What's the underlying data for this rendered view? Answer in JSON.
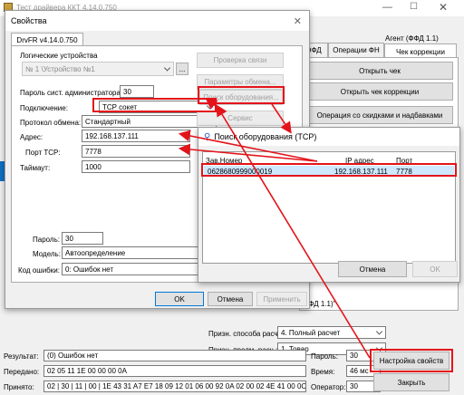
{
  "main_window": {
    "title": "Тест драйвера ККТ 4.14.0.750",
    "tabs": [
      "ОФД",
      "Операции ФН",
      "Чек коррекции"
    ],
    "agent_label": "Агент (ФФД 1.1)",
    "buttons": [
      "Открыть чек",
      "Открыть чек коррекции",
      "Операция со скидками и надбавками"
    ],
    "agent_note": "\"Агент (ФФД 1.1)\"",
    "calc_method_label": "Призн. способа расч.:",
    "calc_method_value": "4. Полный расчет",
    "item_type_label": "Призн. предм. расч.:",
    "item_type_value": "1. Товар",
    "status": {
      "result_label": "Результат:",
      "result_value": "(0) Ошибок нет",
      "sent_label": "Передано:",
      "sent_value": "02 05 11 1E 00 00 00 0A",
      "received_label": "Принято:",
      "received_value": "02 | 30 | 11 | 00 | 1E 43 31 A7 E7 18 09 12 01 06 00 92 0A 02 00 02 4E 41 00 0C",
      "password_label": "Пароль:",
      "password_value": "30",
      "time_label": "Время:",
      "time_value": "46 мс",
      "operator_label": "Оператор:",
      "operator_value": "30"
    },
    "settings_button": "Настройка свойств",
    "close_button": "Закрыть"
  },
  "props_dialog": {
    "title": "Свойства",
    "tab": "DrvFR v4.14.0.750",
    "logical_devices_label": "Логические устройства",
    "logical_device_value": "№ 1 \\Устройство №1",
    "sys_password_label": "Пароль сист. администратора:",
    "sys_password_value": "30",
    "connection_label": "Подключение:",
    "connection_value": "TCP сокет",
    "protocol_label": "Протокол обмена:",
    "protocol_value": "Стандартный",
    "address_label": "Адрес:",
    "address_value": "192.168.137.111",
    "port_label": "Порт TCP:",
    "port_value": "7778",
    "timeout_label": "Таймаут:",
    "timeout_value": "1000",
    "password_label": "Пароль:",
    "password_value": "30",
    "model_label": "Модель:",
    "model_value": "Автоопределение",
    "error_code_label": "Код ошибки:",
    "error_code_value": "0: Ошибок нет",
    "right_buttons": [
      "Проверка связи",
      "Параметры обмена...",
      "Поиск оборудования...",
      "Сервис"
    ],
    "ok": "OK",
    "cancel": "Отмена",
    "apply": "Применить"
  },
  "search_dialog": {
    "title": "Поиск оборудования (TCP)",
    "columns": [
      "Зав.Номер",
      "IP адрес",
      "Порт"
    ],
    "rows": [
      {
        "serial": "0628680999000019",
        "ip": "192.168.137.111",
        "port": "7778"
      }
    ],
    "cancel": "Отмена",
    "ok": "OK"
  },
  "colors": {
    "highlight": "#e3141a",
    "selected_row": "#cde8ff"
  }
}
